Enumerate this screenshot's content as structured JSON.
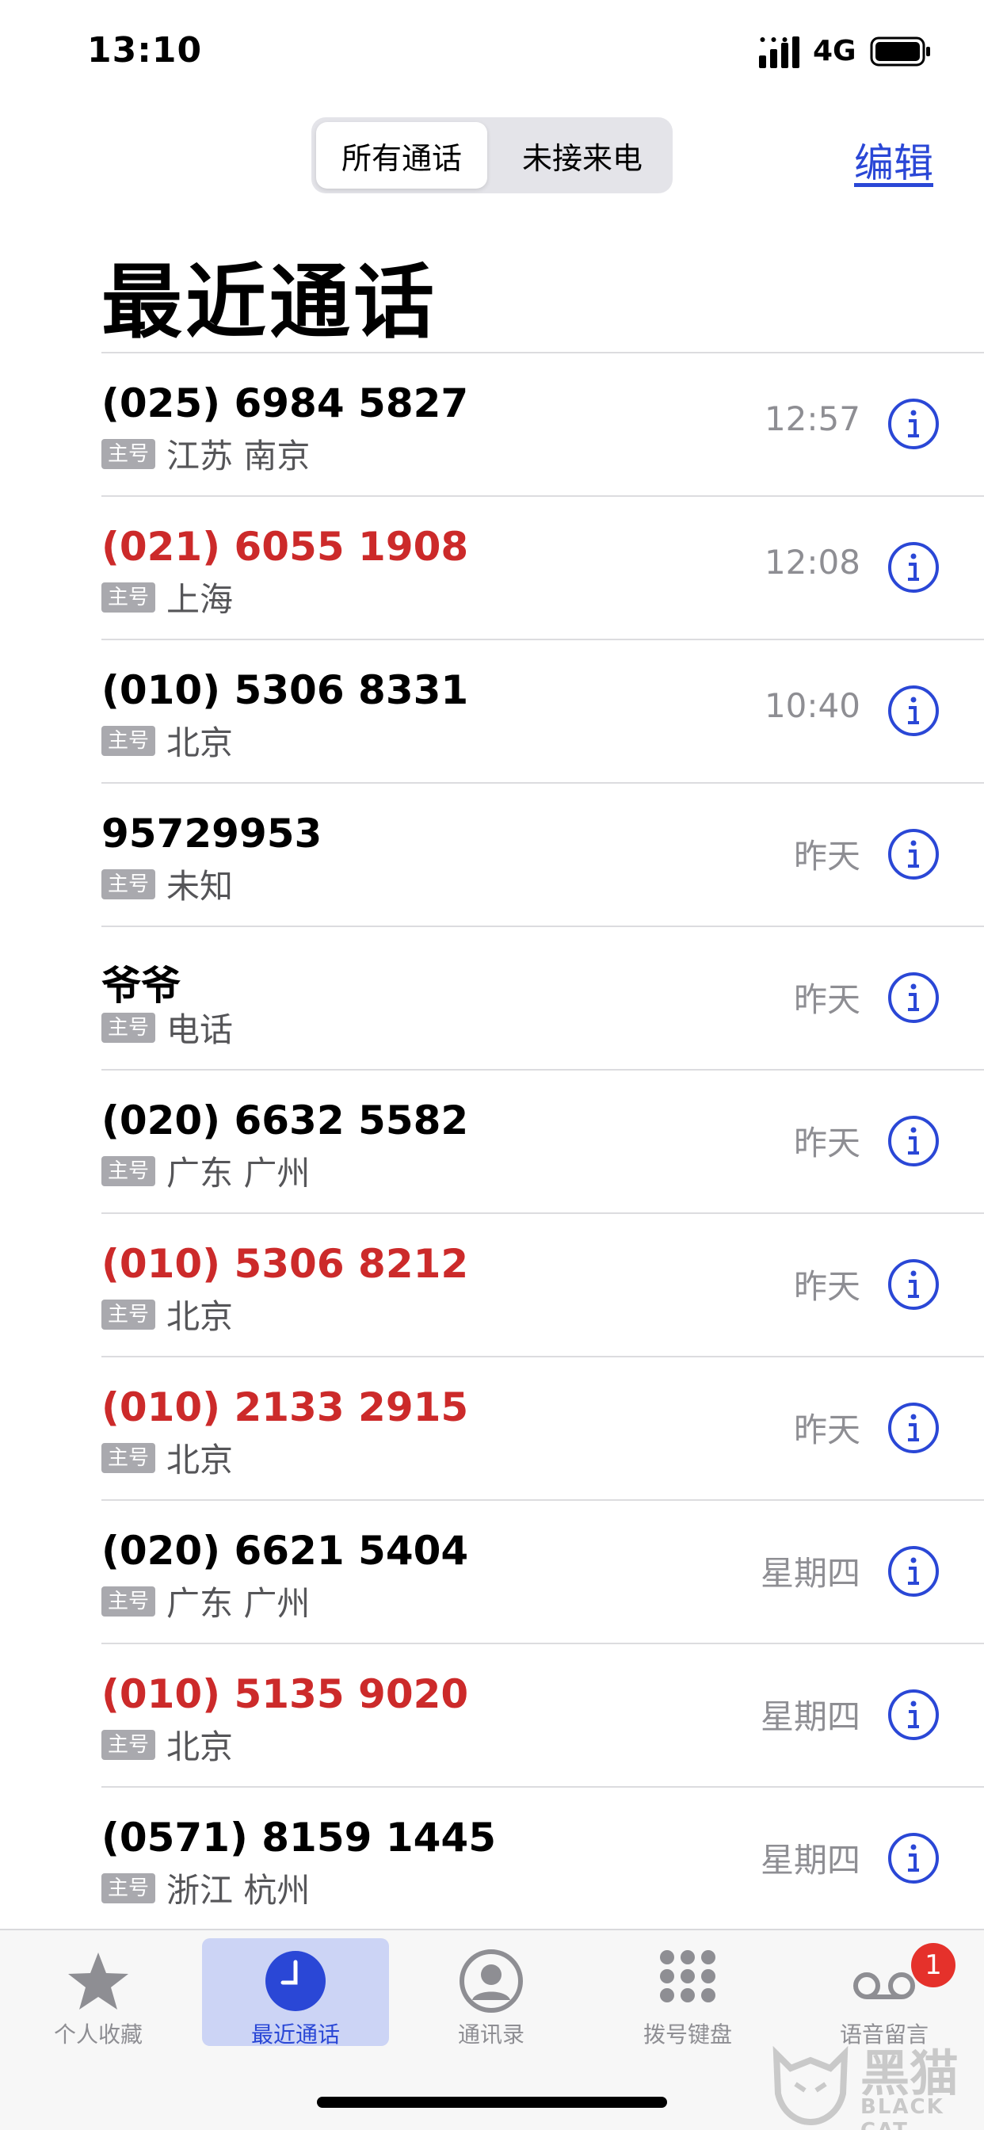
{
  "status_bar": {
    "time": "13:10",
    "network": "4G"
  },
  "segment": {
    "all_calls": "所有通话",
    "missed": "未接来电"
  },
  "edit_label": "编辑",
  "title": "最近通话",
  "tag_label": "主号",
  "colors": {
    "accent": "#2a47d6",
    "missed": "#cc2a2a",
    "secondary": "#8e8e93",
    "badge": "#e5312b"
  },
  "calls": [
    {
      "name": "(025) 6984 5827",
      "location": "江苏 南京",
      "time": "12:57",
      "missed": false
    },
    {
      "name": "(021) 6055 1908",
      "location": "上海",
      "time": "12:08",
      "missed": true
    },
    {
      "name": "(010) 5306 8331",
      "location": "北京",
      "time": "10:40",
      "missed": false
    },
    {
      "name": "95729953",
      "location": "未知",
      "time": "昨天",
      "missed": false
    },
    {
      "name": "爷爷",
      "location": "电话",
      "time": "昨天",
      "missed": false
    },
    {
      "name": "(020) 6632 5582",
      "location": "广东 广州",
      "time": "昨天",
      "missed": false
    },
    {
      "name": "(010) 5306 8212",
      "location": "北京",
      "time": "昨天",
      "missed": true
    },
    {
      "name": "(010) 2133 2915",
      "location": "北京",
      "time": "昨天",
      "missed": true
    },
    {
      "name": "(020) 6621 5404",
      "location": "广东 广州",
      "time": "星期四",
      "missed": false
    },
    {
      "name": "(010) 5135 9020",
      "location": "北京",
      "time": "星期四",
      "missed": true
    },
    {
      "name": "(0571) 8159 1445",
      "location": "浙江 杭州",
      "time": "星期四",
      "missed": false
    }
  ],
  "tabs": [
    {
      "label": "个人收藏",
      "icon": "star-icon"
    },
    {
      "label": "最近通话",
      "icon": "clock-icon",
      "active": true
    },
    {
      "label": "通讯录",
      "icon": "contact-icon"
    },
    {
      "label": "拨号键盘",
      "icon": "keypad-icon"
    },
    {
      "label": "语音留言",
      "icon": "voicemail-icon",
      "badge": "1"
    }
  ],
  "watermark": {
    "title": "黑猫",
    "subtitle": "BLACK CAT"
  }
}
